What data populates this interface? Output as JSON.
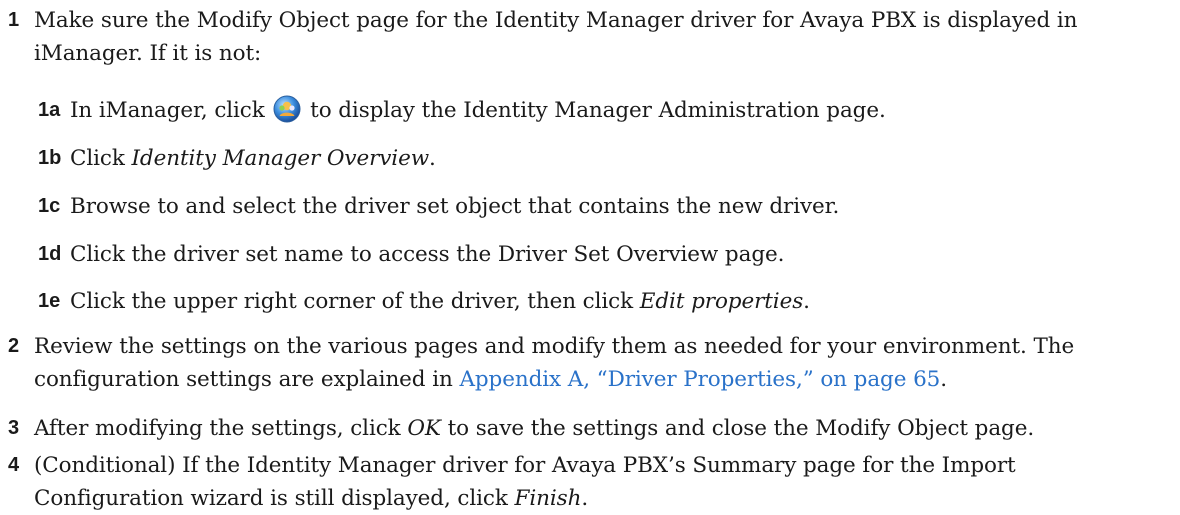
{
  "steps": [
    {
      "number": "1",
      "text": "Make sure the Modify Object page for the Identity Manager driver for Avaya PBX is displayed in iManager. If it is not:",
      "substeps": [
        {
          "number": "1a",
          "text_before": "In iManager, click",
          "icon": "identity-manager-administration-icon",
          "text_after": "to display the Identity Manager Administration page."
        },
        {
          "number": "1b",
          "text_before": "Click ",
          "emphasis": "Identity Manager Overview",
          "text_after": "."
        },
        {
          "number": "1c",
          "text": "Browse to and select the driver set object that contains the new driver."
        },
        {
          "number": "1d",
          "text": "Click the driver set name to access the Driver Set Overview page."
        },
        {
          "number": "1e",
          "text_before": "Click the upper right corner of the driver, then click ",
          "emphasis": "Edit properties",
          "text_after": "."
        }
      ]
    },
    {
      "number": "2",
      "text_line1": "Review the settings on the various pages and modify them as needed for your environment. The",
      "text_line2_before": "configuration settings are explained in ",
      "link": "Appendix A, “Driver Properties,” on page 65",
      "text_line2_after": "."
    },
    {
      "number": "3",
      "text_before": "After modifying the settings, click ",
      "emphasis": "OK",
      "text_after": " to save the settings and close the Modify Object page."
    },
    {
      "number": "4",
      "text_line1": "(Conditional) If the Identity Manager driver for Avaya PBX’s Summary page for the Import",
      "text_line2_before": "Configuration wizard is still displayed, click ",
      "emphasis": "Finish",
      "text_line2_after": "."
    }
  ],
  "colors": {
    "link": "#2a72c9",
    "text": "#1a1a1a"
  }
}
